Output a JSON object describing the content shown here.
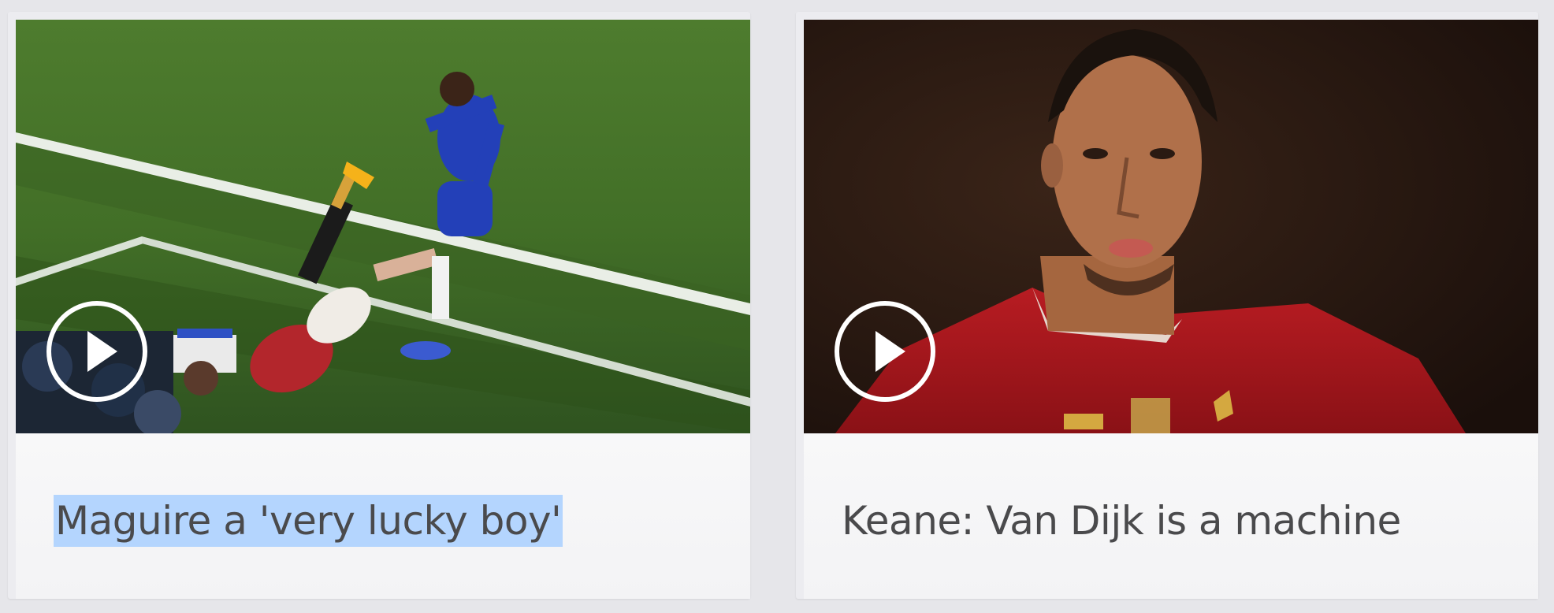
{
  "cards": [
    {
      "headline": "Maguire a 'very lucky boy'",
      "selected": true,
      "thumbnail_subject": "football-tackle-chelsea-vs-manchester-united",
      "play_icon": "play-icon"
    },
    {
      "headline": "Keane: Van Dijk is a machine",
      "selected": false,
      "thumbnail_subject": "liverpool-player-portrait",
      "play_icon": "play-icon"
    }
  ],
  "colors": {
    "page_background": "#e6e6ea",
    "card_background": "#f7f7f8",
    "headline_text": "#4a4a4c",
    "selection_highlight": "#b4d5fe",
    "pitch_green": "#3f6b28",
    "chelsea_blue": "#2440b8",
    "liverpool_red": "#a8151c"
  }
}
